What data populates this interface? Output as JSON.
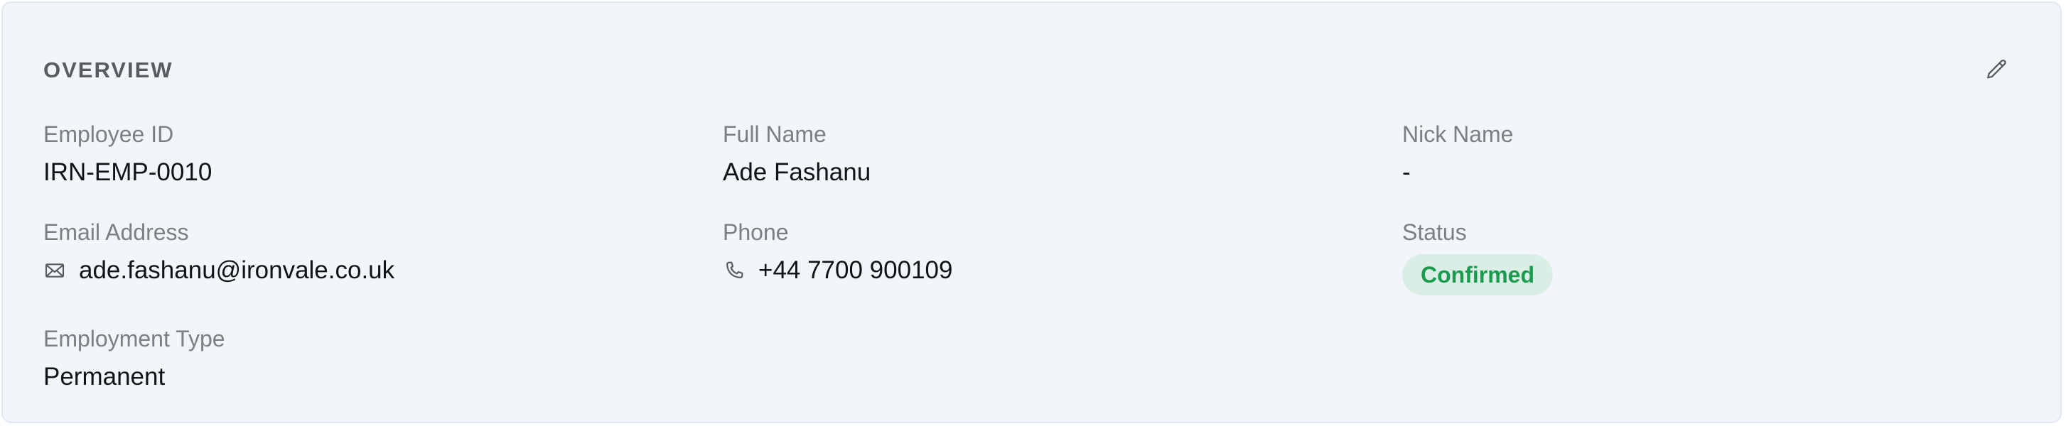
{
  "section": {
    "title": "OVERVIEW"
  },
  "fields": {
    "employee_id": {
      "label": "Employee ID",
      "value": "IRN-EMP-0010"
    },
    "full_name": {
      "label": "Full Name",
      "value": "Ade Fashanu"
    },
    "nick_name": {
      "label": "Nick Name",
      "value": "-"
    },
    "email": {
      "label": "Email Address",
      "value": "ade.fashanu@ironvale.co.uk",
      "icon": "mail-icon"
    },
    "phone": {
      "label": "Phone",
      "value": "+44 7700 900109",
      "icon": "phone-icon"
    },
    "status": {
      "label": "Status",
      "value": "Confirmed",
      "badge_color": "#1a9c4e",
      "badge_bg": "#dbeee6"
    },
    "employment_type": {
      "label": "Employment Type",
      "value": "Permanent"
    }
  },
  "actions": {
    "edit_icon": "pencil-icon"
  }
}
